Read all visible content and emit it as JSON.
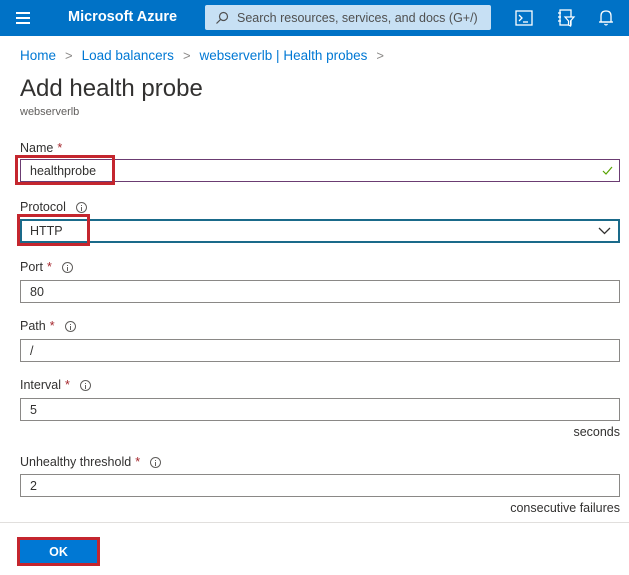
{
  "topbar": {
    "menu_icon": "hamburger-icon",
    "brand": "Microsoft Azure",
    "search_placeholder": "Search resources, services, and docs (G+/)",
    "icons": [
      "cloud-shell-icon",
      "directory-filter-icon",
      "notifications-bell-icon"
    ]
  },
  "breadcrumb": {
    "items": [
      "Home",
      "Load balancers",
      "webserverlb | Health probes"
    ],
    "separator": ">"
  },
  "page": {
    "title": "Add health probe",
    "subtitle": "webserverlb"
  },
  "form": {
    "name": {
      "label": "Name",
      "required": "*",
      "value": "healthprobe",
      "status": "valid"
    },
    "protocol": {
      "label": "Protocol",
      "value": "HTTP"
    },
    "port": {
      "label": "Port",
      "required": "*",
      "value": "80"
    },
    "path": {
      "label": "Path",
      "required": "*",
      "value": "/"
    },
    "interval": {
      "label": "Interval",
      "required": "*",
      "value": "5",
      "unit": "seconds"
    },
    "unhealthy_threshold": {
      "label": "Unhealthy threshold",
      "required": "*",
      "value": "2",
      "unit": "consecutive failures"
    }
  },
  "footer": {
    "ok_label": "OK"
  },
  "colors": {
    "brand": "#0072c6",
    "primary_button": "#0078d4",
    "highlight": "#c4262e",
    "required": "#a4262c"
  }
}
